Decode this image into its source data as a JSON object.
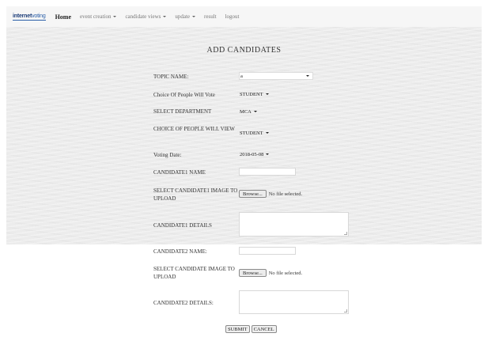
{
  "nav": {
    "brand_part1": "internet",
    "brand_part2": "voting",
    "home": "Home",
    "items": [
      {
        "label": "event creation"
      },
      {
        "label": "candidate views"
      },
      {
        "label": "update"
      },
      {
        "label": "result"
      },
      {
        "label": "logout"
      }
    ]
  },
  "form": {
    "title": "ADD CANDIDATES",
    "topic_name_label": "TOPIC NAME:",
    "topic_name_value": "a",
    "choice_vote_label": "Choice Of People Will Vote",
    "choice_vote_value": "STUDENT",
    "department_label": "SELECT DEPARTMENT",
    "department_value": "MCA",
    "choice_view_label": "CHOICE OF PEOPLE WILL VIEW",
    "choice_view_value": "STUDENT",
    "voting_date_label": "Voting Date:",
    "voting_date_value": "2018-05-08",
    "candidate1_name_label": "CANDIDATE1 NAME",
    "candidate1_image_label": "SELECT CANDIDATE1 IMAGE TO UPLOAD",
    "candidate1_details_label": "CANDIDATE1 DETAILS",
    "candidate2_name_label": "CANDIDATE2 NAME:",
    "candidate2_image_label": "SELECT CANDIDATE IMAGE TO UPLOAD",
    "candidate2_details_label": "CANDIDATE2 DETAILS:",
    "browse_label": "Browse...",
    "no_file_text": "No file selected.",
    "submit_label": "SUBMIT",
    "cancel_label": "CANCEL"
  }
}
